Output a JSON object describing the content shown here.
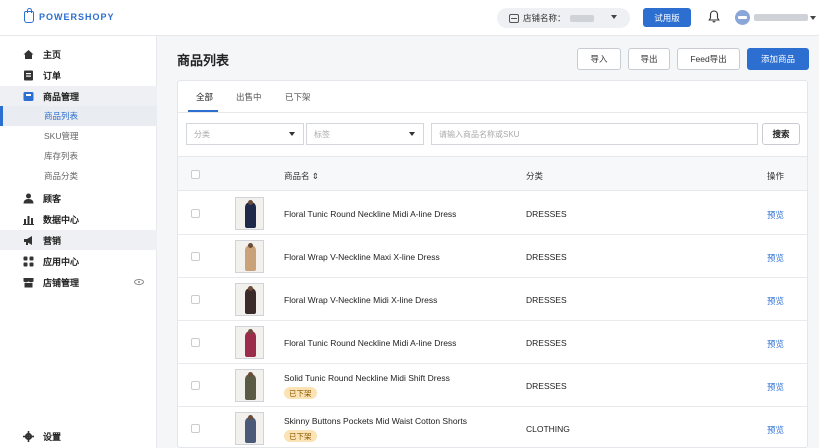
{
  "brand": {
    "logo_text": "POWERSHOPY",
    "accent": "#2c6fd1"
  },
  "topbar": {
    "store_label": "店铺名称：",
    "trial_label": "试用版"
  },
  "sidebar": {
    "items": [
      {
        "label": "主页",
        "icon": "home-icon"
      },
      {
        "label": "订单",
        "icon": "order-icon"
      },
      {
        "label": "商品管理",
        "icon": "product-icon"
      },
      {
        "label": "顾客",
        "icon": "customer-icon"
      },
      {
        "label": "数据中心",
        "icon": "chart-icon"
      },
      {
        "label": "营销",
        "icon": "megaphone-icon"
      },
      {
        "label": "应用中心",
        "icon": "apps-icon"
      },
      {
        "label": "店铺管理",
        "icon": "store-icon"
      }
    ],
    "sub_items": [
      "商品列表",
      "SKU管理",
      "库存列表",
      "商品分类"
    ],
    "settings_label": "设置"
  },
  "page": {
    "title": "商品列表",
    "import_label": "导入",
    "export_label": "导出",
    "feed_export_label": "Feed导出",
    "add_label": "添加商品"
  },
  "tabs": [
    "全部",
    "出售中",
    "已下架"
  ],
  "filters": {
    "category_placeholder": "分类",
    "tag_placeholder": "标签",
    "search_placeholder": "请输入商品名称或SKU",
    "search_button": "搜索"
  },
  "table": {
    "headers": {
      "name": "商品名 ⇕",
      "category": "分类",
      "action": "操作"
    },
    "rows": [
      {
        "name": "Floral Tunic Round Neckline Midi A-line Dress",
        "category": "DRESSES",
        "action": "预览",
        "badge": "",
        "color": "#1f2a4a"
      },
      {
        "name": "Floral Wrap V-Neckline Maxi X-line Dress",
        "category": "DRESSES",
        "action": "预览",
        "badge": "",
        "color": "#c9a27a"
      },
      {
        "name": "Floral Wrap V-Neckline Midi X-line Dress",
        "category": "DRESSES",
        "action": "预览",
        "badge": "",
        "color": "#3a2a2a"
      },
      {
        "name": "Floral Tunic Round Neckline Midi A-line Dress",
        "category": "DRESSES",
        "action": "预览",
        "badge": "",
        "color": "#9b2d4a"
      },
      {
        "name": "Solid Tunic Round Neckline Midi Shift Dress",
        "category": "DRESSES",
        "action": "预览",
        "badge": "已下架",
        "color": "#5a5a45"
      },
      {
        "name": "Skinny Buttons Pockets Mid Waist Cotton Shorts",
        "category": "CLOTHING",
        "action": "预览",
        "badge": "已下架",
        "color": "#4a5a78"
      }
    ]
  }
}
